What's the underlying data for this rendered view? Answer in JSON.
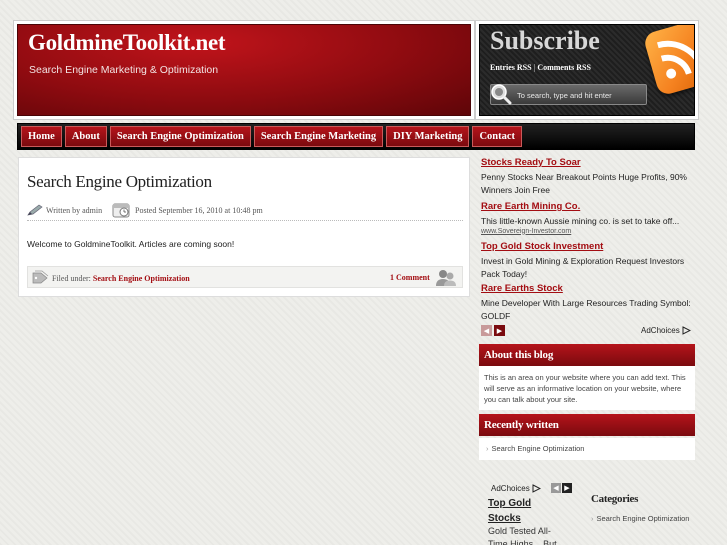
{
  "header": {
    "site_title": "GoldmineToolkit.net",
    "tagline": "Search Engine Marketing & Optimization"
  },
  "subscribe": {
    "title": "Subscribe",
    "entries_rss": "Entries RSS",
    "separator": "|",
    "comments_rss": "Comments RSS",
    "search_placeholder": "To search, type and hit enter",
    "icon": "rss-icon"
  },
  "nav": {
    "items": [
      "Home",
      "About",
      "Search Engine Optimization",
      "Search Engine Marketing",
      "DIY Marketing",
      "Contact"
    ]
  },
  "post": {
    "title": "Search Engine Optimization",
    "author": "Written by admin",
    "date": "Posted September 16, 2010 at 10:48 pm",
    "body": "Welcome to GoldmineToolkit. Articles are coming soon!",
    "filed_label": "Filed under:",
    "filed_category": "Search Engine Optimization",
    "comments": "1 Comment"
  },
  "ads": {
    "items": [
      {
        "title": "Stocks Ready To Soar",
        "text": "Penny Stocks Near Breakout Points Huge Profits, 90% Winners Join Free"
      },
      {
        "title": "Rare Earth Mining Co.",
        "text": "This little-known Aussie mining co. is set to take off...",
        "url": "www.Sovereign-Investor.com"
      },
      {
        "title": "Top Gold Stock Investment",
        "text": "Invest in Gold Mining & Exploration Request Investors Pack Today!"
      },
      {
        "title": "Rare Earths Stock",
        "text": "Mine Developer With Large Resources Trading Symbol: GOLDF"
      }
    ],
    "adchoices": "AdChoices"
  },
  "about": {
    "title": "About this blog",
    "body": "This is an area on your website where you can add text. This will serve as an informative location on your website, where you can talk about your site."
  },
  "recent": {
    "title": "Recently written",
    "item": "Search Engine Optimization"
  },
  "bottom_ad": {
    "adchoices": "AdChoices",
    "title": "Top Gold Stocks",
    "text": "Gold Tested All-Time Highs... But"
  },
  "categories": {
    "title": "Categories",
    "item": "Search Engine Optimization"
  },
  "colors": {
    "brand_red": "#a30d12",
    "dark_red": "#7a0a0e",
    "rss_orange": "#f58220"
  }
}
